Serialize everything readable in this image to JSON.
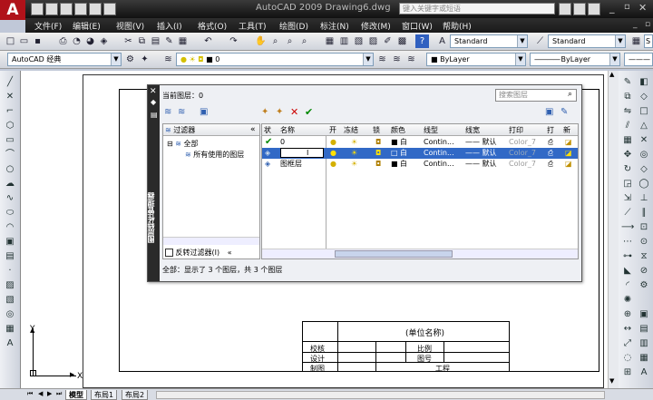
{
  "window": {
    "logo_letter": "A",
    "title": "AutoCAD 2009  Drawing6.dwg",
    "search_placeholder": "键入关键字或短语"
  },
  "menu": [
    "文件(F)",
    "编辑(E)",
    "视图(V)",
    "插入(I)",
    "格式(O)",
    "工具(T)",
    "绘图(D)",
    "标注(N)",
    "修改(M)",
    "窗口(W)",
    "帮助(H)"
  ],
  "toolbar": {
    "text_style": "Standard",
    "dim_style": "Standard",
    "table_style_partial": "S",
    "workspace": "AutoCAD 经典",
    "layer_combo": "0",
    "color_combo": "ByLayer",
    "linetype_combo": "ByLayer"
  },
  "dialog": {
    "side_title": "图层特性管理器",
    "current_layer_label": "当前图层：0",
    "search_placeholder": "搜索图层",
    "filter_header": "过滤器",
    "filter_collapse": "«",
    "filter_tree": [
      "全部",
      "所有使用的图层"
    ],
    "invert_filter_label": "反转过滤器(I)",
    "columns": [
      "状",
      "名称",
      "开",
      "冻结",
      "锁",
      "颜色",
      "线型",
      "线宽",
      "打印",
      "打",
      "新"
    ],
    "layers": [
      {
        "status": "check",
        "name": "0",
        "color_name": "白",
        "linetype": "Contin...",
        "lineweight": "—— 默认",
        "plot_style": "Color_7",
        "selected": false
      },
      {
        "status": "layer",
        "name": "",
        "color_name": "白",
        "linetype": "Contin...",
        "lineweight": "—— 默认",
        "plot_style": "Color_7",
        "selected": true
      },
      {
        "status": "layer",
        "name": "图框层",
        "color_name": "白",
        "linetype": "Contin...",
        "lineweight": "—— 默认",
        "plot_style": "Color_7",
        "selected": false
      }
    ],
    "status_text": "全部：显示了 3 个图层，共 3 个图层"
  },
  "title_block": {
    "header": "(单位名称)",
    "rows": [
      {
        "label": "校核",
        "field": "比例"
      },
      {
        "label": "设计",
        "field": "图号"
      },
      {
        "label": "制图",
        "field": "工程"
      }
    ]
  },
  "ucs": {
    "y": "Y",
    "x": "X"
  },
  "tabs": [
    "模型",
    "布局1",
    "布局2"
  ]
}
